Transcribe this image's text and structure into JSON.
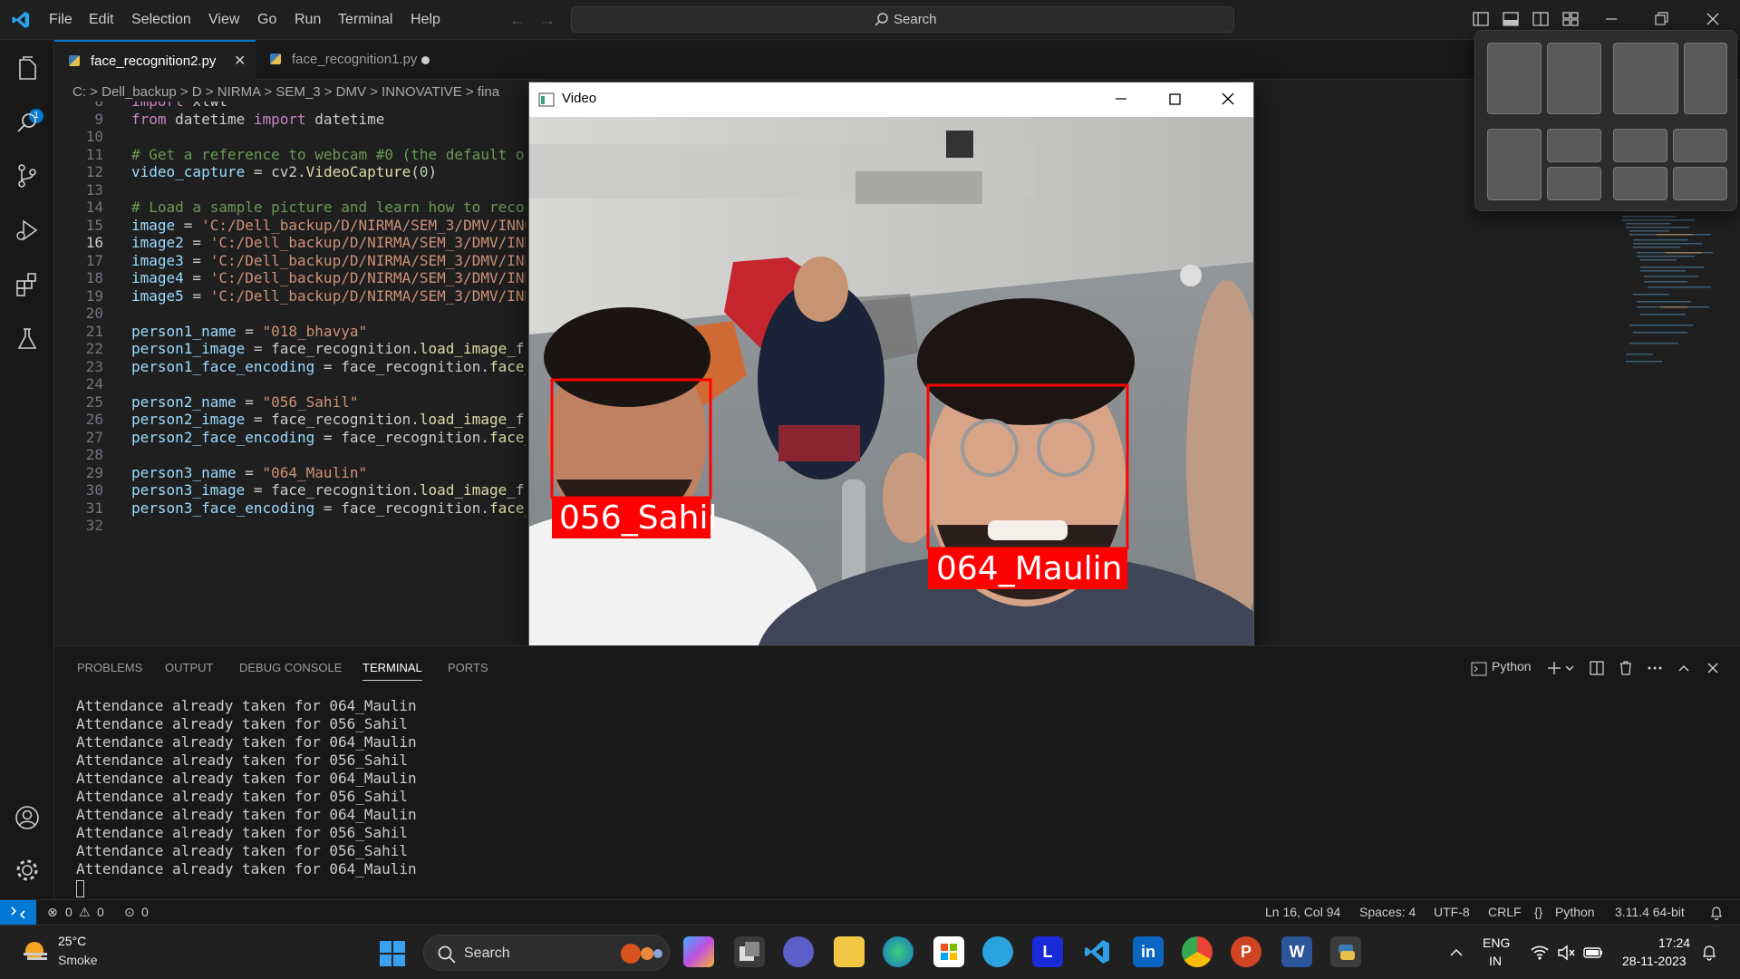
{
  "menu": [
    "File",
    "Edit",
    "Selection",
    "View",
    "Go",
    "Run",
    "Terminal",
    "Help"
  ],
  "search": {
    "label": "Search"
  },
  "activity_badge": "1",
  "tabs": [
    {
      "name": "face_recognition2.py"
    },
    {
      "name": "face_recognition1.py"
    }
  ],
  "breadcrumb": [
    "C:",
    "Dell_backup",
    "D",
    "NIRMA",
    "SEM_3",
    "DMV",
    "INNOVATIVE",
    "fina"
  ],
  "code_lines": [
    {
      "n": "8",
      "t": "import xlwt"
    },
    {
      "n": "9",
      "t": "from datetime import datetime"
    },
    {
      "n": "10",
      "t": ""
    },
    {
      "n": "11",
      "t": "# Get a reference to webcam #0 (the default on"
    },
    {
      "n": "12",
      "t": "video_capture = cv2.VideoCapture(0)"
    },
    {
      "n": "13",
      "t": ""
    },
    {
      "n": "14",
      "t": "# Load a sample picture and learn how to recog"
    },
    {
      "n": "15",
      "t": "image = 'C:/Dell_backup/D/NIRMA/SEM_3/DMV/INNO"
    },
    {
      "n": "16",
      "t": "image2 = 'C:/Dell_backup/D/NIRMA/SEM_3/DMV/INN"
    },
    {
      "n": "17",
      "t": "image3 = 'C:/Dell_backup/D/NIRMA/SEM_3/DMV/INN"
    },
    {
      "n": "18",
      "t": "image4 = 'C:/Dell_backup/D/NIRMA/SEM_3/DMV/INN"
    },
    {
      "n": "19",
      "t": "image5 = 'C:/Dell_backup/D/NIRMA/SEM_3/DMV/INN"
    },
    {
      "n": "20",
      "t": ""
    },
    {
      "n": "21",
      "t": "person1_name = \"018_bhavya\""
    },
    {
      "n": "22",
      "t": "person1_image = face_recognition.load_image_fi"
    },
    {
      "n": "23",
      "t": "person1_face_encoding = face_recognition.face_"
    },
    {
      "n": "24",
      "t": ""
    },
    {
      "n": "25",
      "t": "person2_name = \"056_Sahil\""
    },
    {
      "n": "26",
      "t": "person2_image = face_recognition.load_image_fi"
    },
    {
      "n": "27",
      "t": "person2_face_encoding = face_recognition.face_"
    },
    {
      "n": "28",
      "t": ""
    },
    {
      "n": "29",
      "t": "person3_name = \"064_Maulin\""
    },
    {
      "n": "30",
      "t": "person3_image = face_recognition.load_image_fi"
    },
    {
      "n": "31",
      "t": "person3_face_encoding = face_recognition.face_"
    },
    {
      "n": "32",
      "t": ""
    }
  ],
  "video_window": {
    "title": "Video",
    "labels": [
      "056_Sahil",
      "064_Maulin"
    ]
  },
  "panel_tabs": [
    "PROBLEMS",
    "OUTPUT",
    "DEBUG CONSOLE",
    "TERMINAL",
    "PORTS"
  ],
  "terminal_shell": "Python",
  "terminal_lines": [
    "Attendance already taken for 064_Maulin",
    "Attendance already taken for 056_Sahil",
    "Attendance already taken for 064_Maulin",
    "Attendance already taken for 056_Sahil",
    "Attendance already taken for 064_Maulin",
    "Attendance already taken for 056_Sahil",
    "Attendance already taken for 064_Maulin",
    "Attendance already taken for 056_Sahil",
    "Attendance already taken for 056_Sahil",
    "Attendance already taken for 064_Maulin"
  ],
  "status": {
    "errors": "0",
    "warnings": "0",
    "ports": "0",
    "position": "Ln 16, Col 94",
    "spaces": "Spaces: 4",
    "encoding": "UTF-8",
    "eol": "CRLF",
    "language": "Python",
    "interpreter": "3.11.4 64-bit"
  },
  "taskbar": {
    "temp": "25°C",
    "weather": "Smoke",
    "search": "Search",
    "lang1": "ENG",
    "lang2": "IN",
    "time": "17:24",
    "date": "28-11-2023"
  },
  "colors": {
    "accent": "#0078d4",
    "face_box": "#ff0000"
  }
}
